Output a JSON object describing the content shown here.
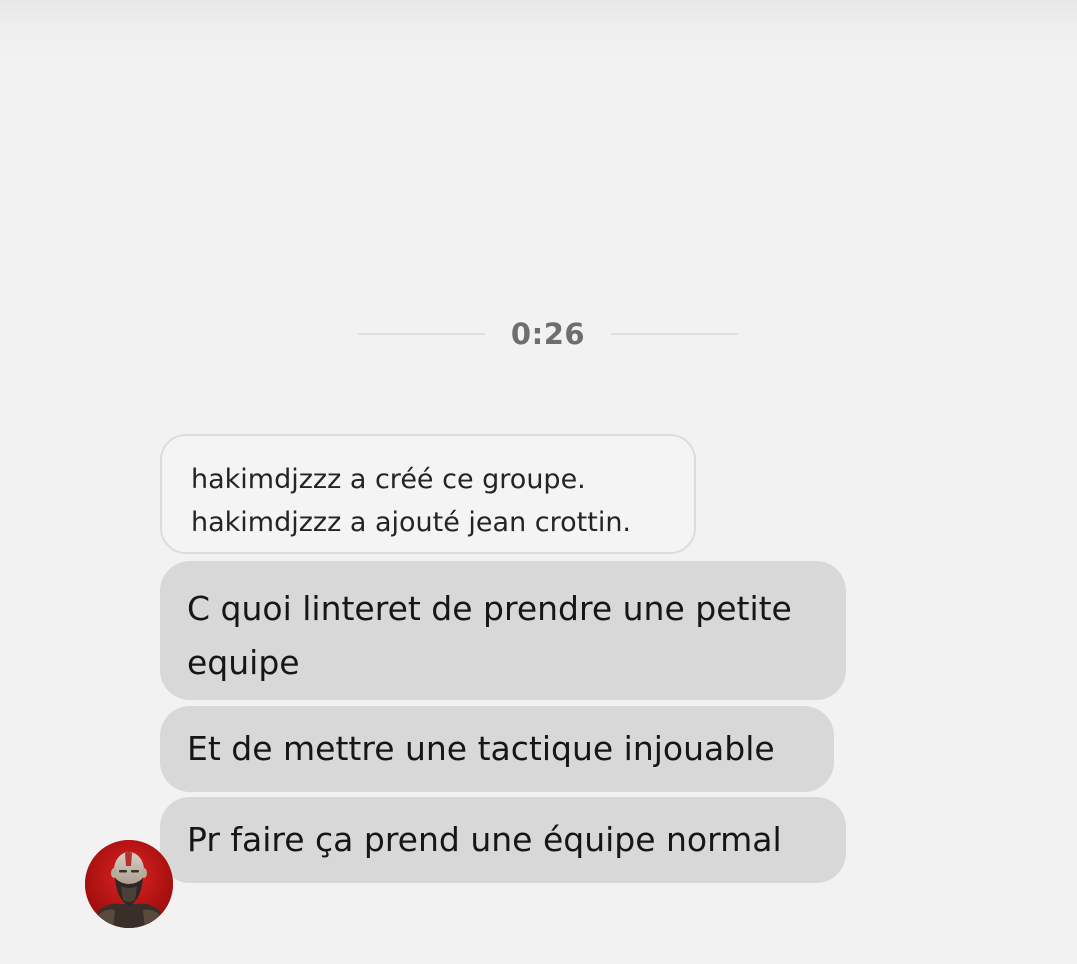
{
  "timestamp": "0:26",
  "system_notice": {
    "line1": "hakimdjzzz a créé ce groupe.",
    "line2": "hakimdjzzz a ajouté jean crottin."
  },
  "messages": [
    {
      "text": "C quoi linteret de prendre une petite equipe"
    },
    {
      "text": "Et de mettre une tactique injouable"
    },
    {
      "text": "Pr faire ça prend une équipe normal"
    }
  ],
  "sender": {
    "avatar_icon": "warrior-portrait-icon",
    "avatar_bg": "#c41616"
  },
  "colors": {
    "background": "#f2f2f2",
    "bubble": "#d8d8d8",
    "timestamp": "#6e6e6e"
  }
}
